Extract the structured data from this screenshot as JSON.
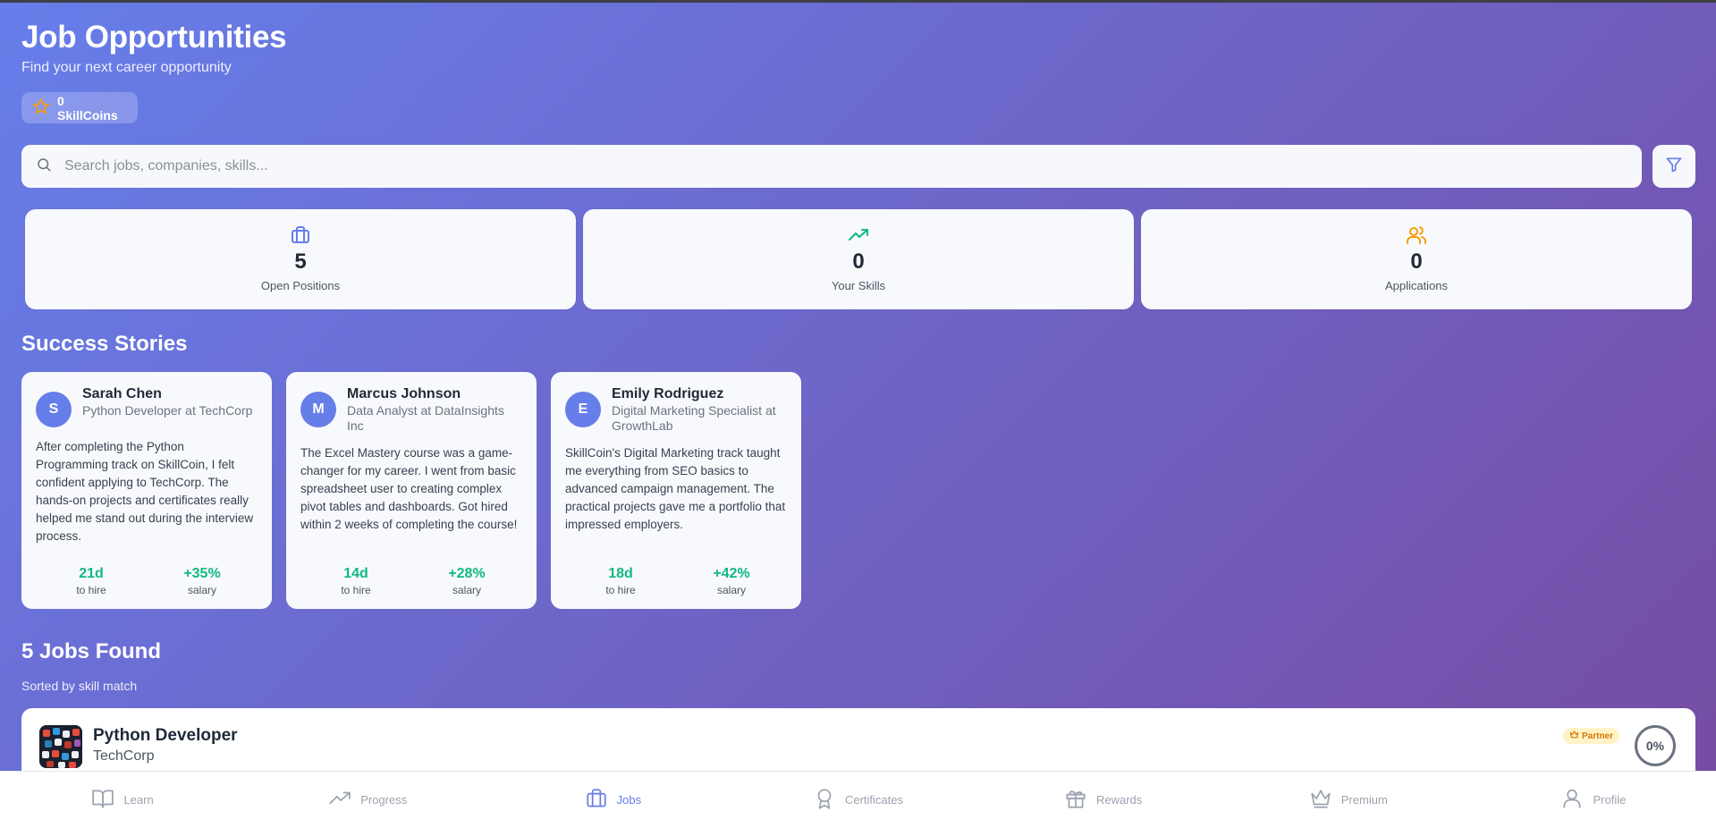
{
  "header": {
    "title": "Job Opportunities",
    "subtitle": "Find your next career opportunity",
    "coins_label": "0 SkillCoins"
  },
  "search": {
    "placeholder": "Search jobs, companies, skills..."
  },
  "stats": [
    {
      "icon": "briefcase-icon",
      "value": "5",
      "label": "Open Positions",
      "color": "#667eea"
    },
    {
      "icon": "trending-up-icon",
      "value": "0",
      "label": "Your Skills",
      "color": "#10b981"
    },
    {
      "icon": "users-icon",
      "value": "0",
      "label": "Applications",
      "color": "#f59e0b"
    }
  ],
  "success": {
    "heading": "Success Stories",
    "stories": [
      {
        "initial": "S",
        "name": "Sarah Chen",
        "role": "Python Developer at TechCorp",
        "quote": "After completing the Python Programming track on SkillCoin, I felt confident applying to TechCorp. The hands-on projects and certificates really helped me stand out during the interview process.",
        "days": "21d",
        "days_label": "to hire",
        "salary": "+35%",
        "salary_label": "salary"
      },
      {
        "initial": "M",
        "name": "Marcus Johnson",
        "role": "Data Analyst at DataInsights Inc",
        "quote": "The Excel Mastery course was a game-changer for my career. I went from basic spreadsheet user to creating complex pivot tables and dashboards. Got hired within 2 weeks of completing the course!",
        "days": "14d",
        "days_label": "to hire",
        "salary": "+28%",
        "salary_label": "salary"
      },
      {
        "initial": "E",
        "name": "Emily Rodriguez",
        "role": "Digital Marketing Specialist at GrowthLab",
        "quote": "SkillCoin's Digital Marketing track taught me everything from SEO basics to advanced campaign management. The practical projects gave me a portfolio that impressed employers.",
        "days": "18d",
        "days_label": "to hire",
        "salary": "+42%",
        "salary_label": "salary"
      }
    ]
  },
  "jobs": {
    "heading": "5 Jobs Found",
    "sort_label": "Sorted by skill match",
    "items": [
      {
        "title": "Python Developer",
        "company": "TechCorp",
        "badge": "Partner",
        "match": "0%"
      }
    ]
  },
  "nav": {
    "items": [
      {
        "label": "Learn",
        "icon": "book-icon"
      },
      {
        "label": "Progress",
        "icon": "trending-up-icon"
      },
      {
        "label": "Jobs",
        "icon": "briefcase-icon",
        "active": true
      },
      {
        "label": "Certificates",
        "icon": "award-icon"
      },
      {
        "label": "Rewards",
        "icon": "gift-icon"
      },
      {
        "label": "Premium",
        "icon": "crown-icon"
      },
      {
        "label": "Profile",
        "icon": "user-icon"
      }
    ]
  },
  "colors": {
    "gradient_start": "#667eea",
    "gradient_end": "#764ba2",
    "accent": "#667eea",
    "success": "#10b981",
    "warning": "#f59e0b"
  }
}
